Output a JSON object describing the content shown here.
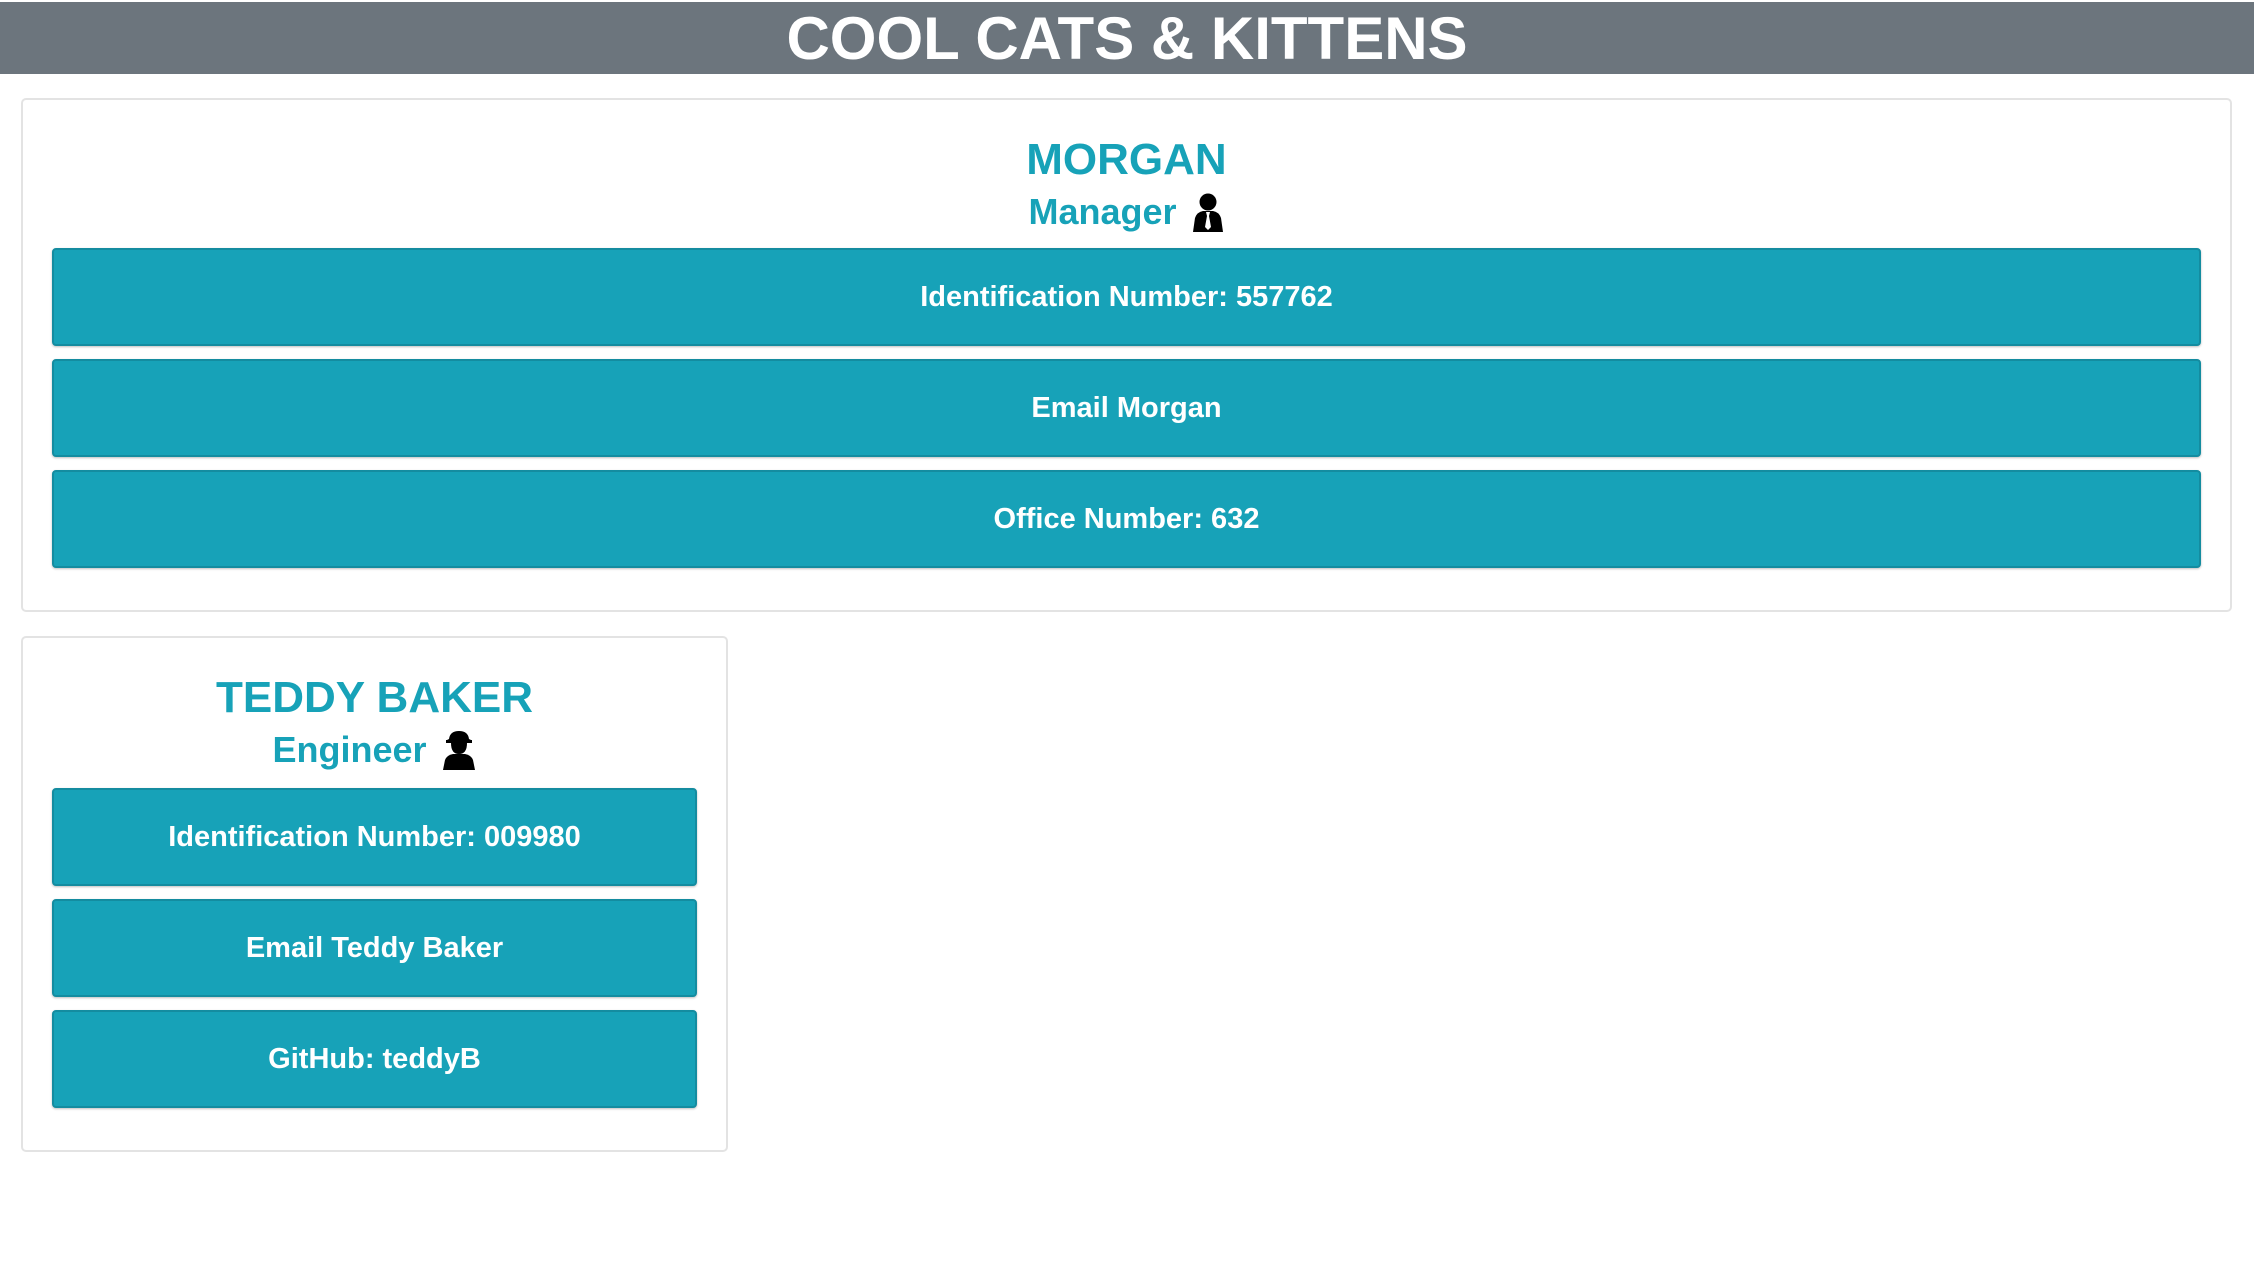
{
  "header": {
    "title": "COOL CATS & KITTENS"
  },
  "colors": {
    "header_bg": "#6c757d",
    "accent": "#17a2b8",
    "white": "#ffffff"
  },
  "cards": [
    {
      "name": "MORGAN",
      "role": "Manager",
      "role_icon": "manager-person-icon",
      "rows": [
        "Identification Number: 557762",
        "Email Morgan",
        "Office Number: 632"
      ]
    },
    {
      "name": "TEDDY BAKER",
      "role": "Engineer",
      "role_icon": "engineer-person-icon",
      "rows": [
        "Identification Number: 009980",
        "Email Teddy Baker",
        "GitHub: teddyB"
      ]
    }
  ]
}
